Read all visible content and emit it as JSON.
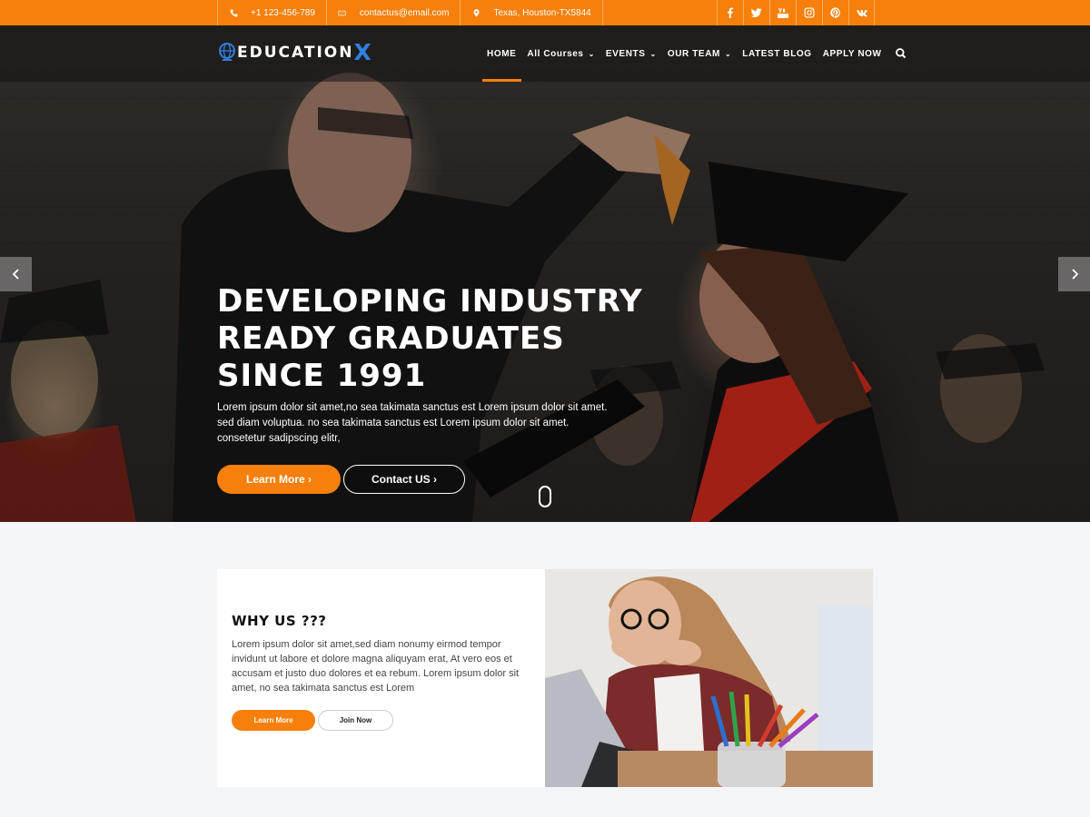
{
  "topbar": {
    "phone": "+1 123-456-789",
    "email": "contactus@email.com",
    "address": "Texas, Houston-TX5844",
    "social": [
      "facebook-icon",
      "twitter-icon",
      "youtube-icon",
      "instagram-icon",
      "pinterest-icon",
      "vk-icon"
    ]
  },
  "logo": {
    "text": "EDUCATION",
    "accent": "X"
  },
  "nav": {
    "items": [
      "HOME",
      "All Courses",
      "EVENTS",
      "OUR TEAM",
      "LATEST BLOG",
      "APPLY NOW"
    ],
    "active": "HOME"
  },
  "hero": {
    "title_lines": [
      "DEVELOPING INDUSTRY",
      "READY GRADUATES",
      "SINCE 1991"
    ],
    "description": "Lorem ipsum dolor sit amet,no sea takimata sanctus est Lorem ipsum dolor sit amet. sed diam voluptua. no sea takimata sanctus est Lorem ipsum dolor sit amet. consetetur sadipscing elitr,",
    "btn_primary": "Learn More",
    "btn_secondary": "Contact US"
  },
  "why": {
    "title": "WHY US ???",
    "description": "Lorem ipsum dolor sit amet,sed diam nonumy eirmod tempor invidunt ut labore et dolore magna aliquyam erat, At vero eos et accusam et justo duo dolores et ea rebum. Lorem ipsum dolor sit amet, no sea takimata sanctus est Lorem",
    "btn_primary": "Learn More",
    "btn_secondary": "Join Now"
  },
  "colors": {
    "accent": "#f6800b",
    "logo_x": "#2f7fe0",
    "page_bg": "#f4f5f8"
  }
}
